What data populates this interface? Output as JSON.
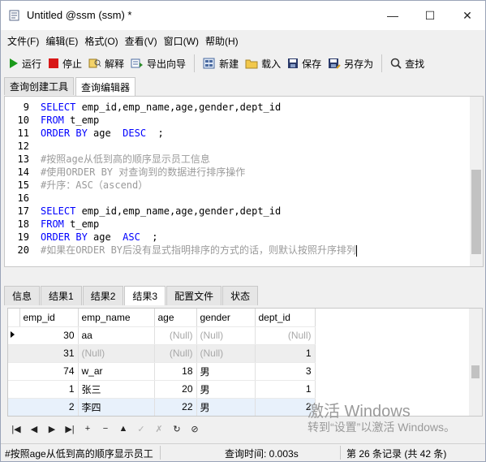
{
  "window": {
    "title": "Untitled @ssm (ssm) *",
    "controls": {
      "minimize": "—",
      "maximize": "☐",
      "close": "✕"
    }
  },
  "menu": [
    "文件(F)",
    "编辑(E)",
    "格式(O)",
    "查看(V)",
    "窗口(W)",
    "帮助(H)"
  ],
  "toolbar": {
    "run": "运行",
    "stop": "停止",
    "explain": "解释",
    "export": "导出向导",
    "new": "新建",
    "load": "载入",
    "save": "保存",
    "save_as": "另存为",
    "find": "查找"
  },
  "top_tabs": [
    "查询创建工具",
    "查询编辑器"
  ],
  "editor": {
    "lines": [
      {
        "n": "9",
        "kind": "code",
        "parts": [
          [
            "kw",
            "SELECT"
          ],
          [
            "t",
            " emp_id,emp_name,age,gender,dept_id"
          ]
        ]
      },
      {
        "n": "10",
        "kind": "code",
        "parts": [
          [
            "kw",
            "FROM"
          ],
          [
            "t",
            " t_emp"
          ]
        ]
      },
      {
        "n": "11",
        "kind": "code",
        "parts": [
          [
            "kw",
            "ORDER BY"
          ],
          [
            "t",
            " age  "
          ],
          [
            "kw",
            "DESC"
          ],
          [
            "t",
            "  ;"
          ]
        ]
      },
      {
        "n": "12",
        "kind": "code",
        "parts": []
      },
      {
        "n": "13",
        "kind": "code",
        "parts": [
          [
            "cm",
            "#按照age从低到高的顺序显示员工信息"
          ]
        ]
      },
      {
        "n": "14",
        "kind": "code",
        "parts": [
          [
            "cm",
            "#使用ORDER BY 对查询到的数据进行排序操作"
          ]
        ]
      },
      {
        "n": "15",
        "kind": "code",
        "parts": [
          [
            "cm",
            "#升序：ASC（ascend）"
          ]
        ]
      },
      {
        "n": "16",
        "kind": "code",
        "parts": []
      },
      {
        "n": "17",
        "kind": "code",
        "parts": [
          [
            "kw",
            "SELECT"
          ],
          [
            "t",
            " emp_id,emp_name,age,gender,dept_id"
          ]
        ]
      },
      {
        "n": "18",
        "kind": "code",
        "parts": [
          [
            "kw",
            "FROM"
          ],
          [
            "t",
            " t_emp"
          ]
        ]
      },
      {
        "n": "19",
        "kind": "code",
        "parts": [
          [
            "kw",
            "ORDER BY"
          ],
          [
            "t",
            " age  "
          ],
          [
            "kw",
            "ASC"
          ],
          [
            "t",
            "  ;"
          ]
        ]
      },
      {
        "n": "20",
        "kind": "code",
        "parts": [
          [
            "cm",
            "#如果在ORDER BY后没有显式指明排序的方式的话，则默认按照升序排列"
          ]
        ]
      }
    ]
  },
  "result_tabs": [
    "信息",
    "结果1",
    "结果2",
    "结果3",
    "配置文件",
    "状态"
  ],
  "grid": {
    "columns": [
      "emp_id",
      "emp_name",
      "age",
      "gender",
      "dept_id"
    ],
    "rows": [
      [
        "30",
        "aa",
        "(Null)",
        "(Null)",
        "(Null)"
      ],
      [
        "31",
        "(Null)",
        "(Null)",
        "(Null)",
        "1"
      ],
      [
        "74",
        "w_ar",
        "18",
        "男",
        "3"
      ],
      [
        "1",
        "张三",
        "20",
        "男",
        "1"
      ],
      [
        "2",
        "李四",
        "22",
        "男",
        "2"
      ]
    ]
  },
  "nav": [
    "|◀",
    "◀",
    "▶",
    "▶|",
    "+",
    "−",
    "▲",
    "✓",
    "✗",
    "↻",
    "⊘"
  ],
  "watermark": {
    "line1": "激活 Windows",
    "line2": "转到“设置”以激活 Windows。"
  },
  "status": {
    "query": "#按照age从低到高的顺序显示员工",
    "time": "查询时间: 0.003s",
    "records": "第 26 条记录 (共 42 条)"
  }
}
